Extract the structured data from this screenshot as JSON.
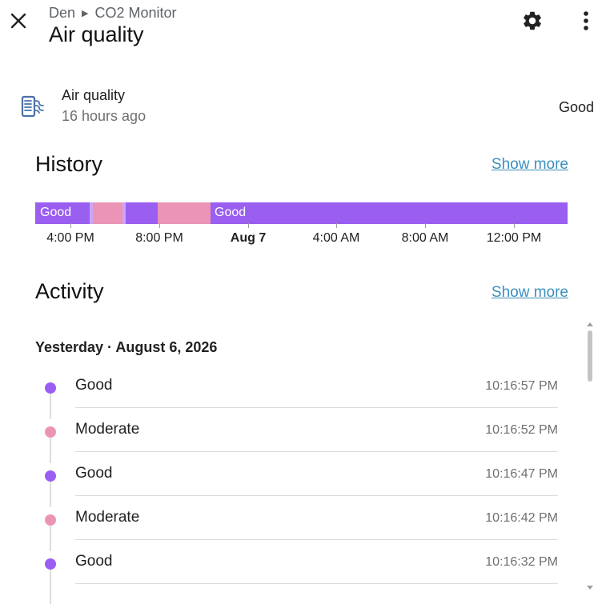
{
  "header": {
    "breadcrumb_area": "Den",
    "breadcrumb_device": "CO2 Monitor",
    "title": "Air quality",
    "icons": {
      "close": "close-icon",
      "settings": "gear-icon",
      "menu": "more-vertical-icon"
    }
  },
  "entity": {
    "icon": "air-filter-icon",
    "name": "Air quality",
    "last_changed": "16 hours ago",
    "state": "Good"
  },
  "history": {
    "title": "History",
    "show_more": "Show more",
    "colors": {
      "good": "#9a5ef0",
      "moderate": "#ec94b5"
    },
    "timeline_labels": [
      "Good",
      "Good"
    ],
    "ticks": [
      {
        "label": "4:00 PM",
        "bold": false
      },
      {
        "label": "8:00 PM",
        "bold": false
      },
      {
        "label": "Aug 7",
        "bold": true
      },
      {
        "label": "4:00 AM",
        "bold": false
      },
      {
        "label": "8:00 AM",
        "bold": false
      },
      {
        "label": "12:00 PM",
        "bold": false
      }
    ]
  },
  "activity": {
    "title": "Activity",
    "show_more": "Show more",
    "date_header": "Yesterday · August 6, 2026",
    "items": [
      {
        "state": "Good",
        "time": "10:16:57 PM",
        "color": "#9a5ef0"
      },
      {
        "state": "Moderate",
        "time": "10:16:52 PM",
        "color": "#ec94b5"
      },
      {
        "state": "Good",
        "time": "10:16:47 PM",
        "color": "#9a5ef0"
      },
      {
        "state": "Moderate",
        "time": "10:16:42 PM",
        "color": "#ec94b5"
      },
      {
        "state": "Good",
        "time": "10:16:32 PM",
        "color": "#9a5ef0"
      }
    ]
  }
}
